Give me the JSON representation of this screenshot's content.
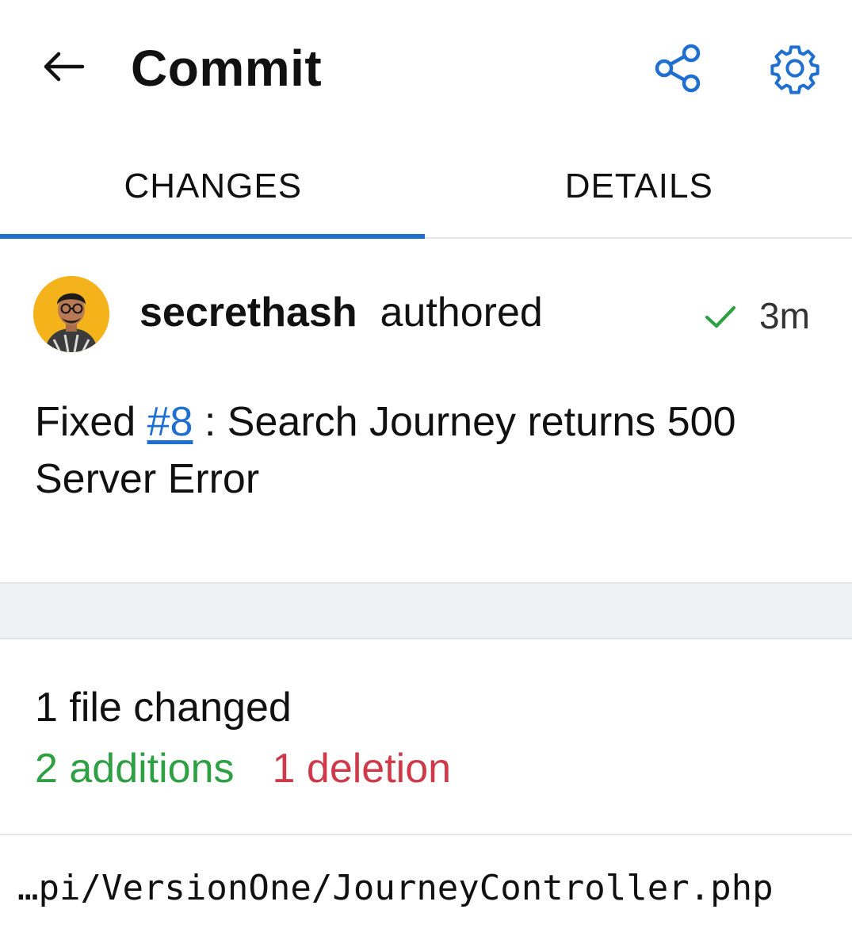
{
  "header": {
    "title": "Commit",
    "back_icon": "arrow-left-icon",
    "share_icon": "share-icon",
    "settings_icon": "gear-icon"
  },
  "colors": {
    "accent": "#1f6fd1",
    "additions": "#2ea043",
    "deletions": "#cf3a4a",
    "band": "#eef0f4"
  },
  "tabs": [
    {
      "label": "CHANGES",
      "active": true
    },
    {
      "label": "DETAILS",
      "active": false
    }
  ],
  "commit": {
    "author": "secrethash",
    "action": "authored",
    "status_icon": "checkmark-icon",
    "time": "3m",
    "message_prefix": "Fixed ",
    "issue_ref": "#8",
    "message_suffix": " : Search Journey returns 500 Server Error"
  },
  "stats": {
    "files_changed": "1 file changed",
    "additions": "2 additions",
    "deletions": "1 deletion"
  },
  "files": [
    {
      "path": "…pi/VersionOne/JourneyController.php"
    }
  ]
}
